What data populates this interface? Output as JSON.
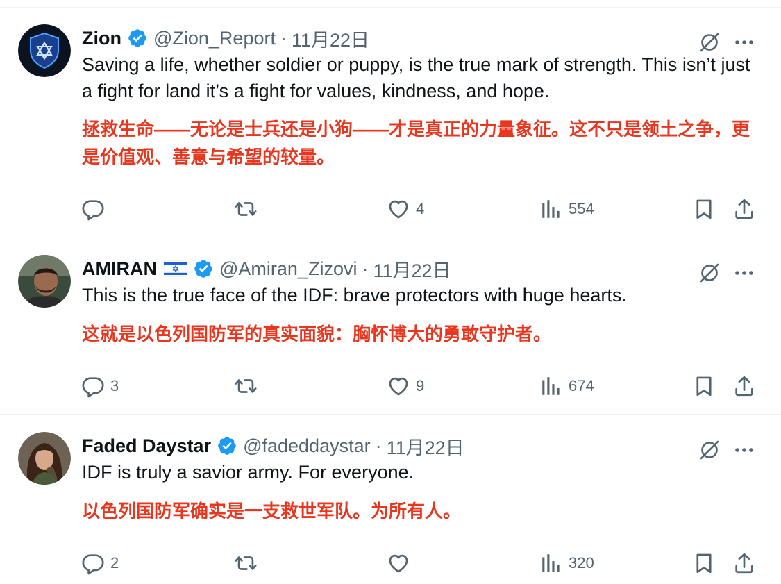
{
  "colors": {
    "accent": "#1d9bf0",
    "muted": "#536471",
    "translation": "#e8361f",
    "divider": "#eff3f4"
  },
  "tweets": [
    {
      "name": "Zion",
      "handle": "@Zion_Report",
      "separator": "·",
      "time": "11月22日",
      "verified": true,
      "flag": false,
      "avatar": "shield-star-avatar",
      "text": "Saving a life, whether soldier or puppy, is the true mark of strength. This isn’t just a fight for land it’s a fight for values, kindness, and hope.",
      "translation": "拯救生命——无论是士兵还是小狗——才是真正的力量象征。这不只是领土之争，更是价值观、善意与希望的较量。",
      "replies": "",
      "likes": "4",
      "views": "554"
    },
    {
      "name": "AMIRAN",
      "handle": "@Amiran_Zizovi",
      "separator": "·",
      "time": "11月22日",
      "verified": true,
      "flag": true,
      "avatar": "man-portrait-avatar",
      "text": "This is the true face of the IDF: brave protectors with huge hearts.",
      "translation": "这就是以色列国防军的真实面貌：胸怀博大的勇敢守护者。",
      "replies": "3",
      "likes": "9",
      "views": "674"
    },
    {
      "name": "Faded Daystar",
      "handle": "@fadeddaystar",
      "separator": "·",
      "time": "11月22日",
      "verified": true,
      "flag": false,
      "avatar": "woman-portrait-avatar",
      "text": "IDF is truly a savior army. For everyone.",
      "translation": "以色列国防军确实是一支救世军队。为所有人。",
      "replies": "2",
      "likes": "",
      "views": "320"
    }
  ]
}
